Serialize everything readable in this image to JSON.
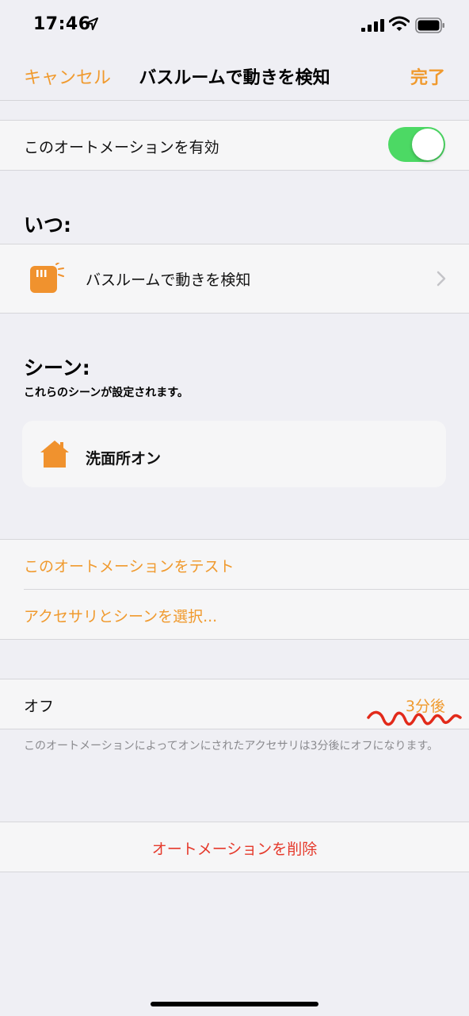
{
  "status_bar": {
    "time": "17:46"
  },
  "nav": {
    "cancel_label": "キャンセル",
    "title": "バスルームで動きを検知",
    "done_label": "完了"
  },
  "enable_row": {
    "label": "このオートメーションを有効",
    "enabled": true
  },
  "when_section": {
    "heading": "いつ:",
    "trigger_label": "バスルームで動きを検知"
  },
  "scenes_section": {
    "heading": "シーン:",
    "subheading": "これらのシーンが設定されます。",
    "scene_name": "洗面所オン"
  },
  "actions": {
    "test_label": "このオートメーションをテスト",
    "select_label": "アクセサリとシーンを選択..."
  },
  "off_row": {
    "label": "オフ",
    "value": "3分後",
    "footnote": "このオートメーションによってオンにされたアクセサリは3分後にオフになります。"
  },
  "delete": {
    "label": "オートメーションを削除"
  },
  "colors": {
    "accent": "#f09a2e",
    "toggle_on": "#4cd964",
    "destructive": "#e5392b",
    "background": "#efeff4"
  },
  "icons": {
    "trigger": "motion-sensor-icon",
    "scene": "house-icon"
  }
}
